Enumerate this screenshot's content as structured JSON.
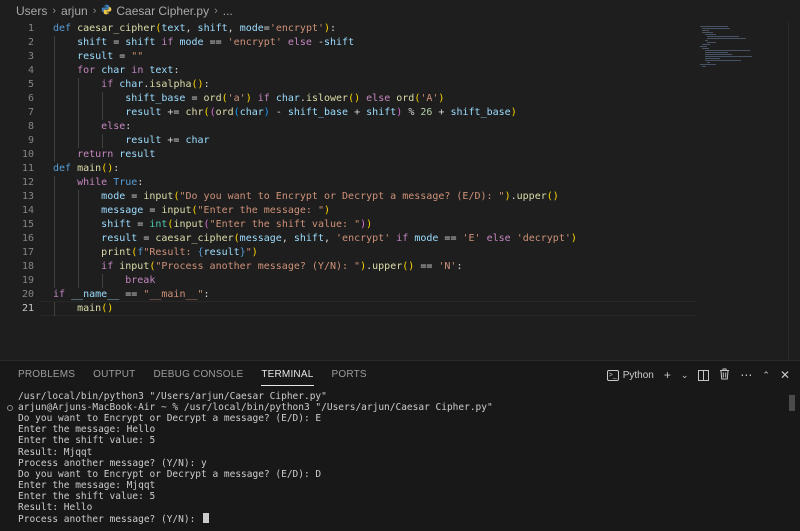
{
  "breadcrumb": {
    "items": [
      "Users",
      "arjun",
      "Caesar Cipher.py",
      "..."
    ]
  },
  "editor": {
    "active_line": 21,
    "lines": [
      [
        [
          "kw",
          "def "
        ],
        [
          "fn",
          "caesar_cipher"
        ],
        [
          "br1",
          "("
        ],
        [
          "var",
          "text"
        ],
        [
          "op",
          ", "
        ],
        [
          "var",
          "shift"
        ],
        [
          "op",
          ", "
        ],
        [
          "var",
          "mode"
        ],
        [
          "op",
          "="
        ],
        [
          "str",
          "'encrypt'"
        ],
        [
          "br1",
          ")"
        ],
        [
          "op",
          ":"
        ]
      ],
      [
        [
          "op",
          "    "
        ],
        [
          "var",
          "shift"
        ],
        [
          "op",
          " = "
        ],
        [
          "var",
          "shift"
        ],
        [
          "ctl",
          " if "
        ],
        [
          "var",
          "mode"
        ],
        [
          "op",
          " == "
        ],
        [
          "str",
          "'encrypt'"
        ],
        [
          "ctl",
          " else "
        ],
        [
          "op",
          "-"
        ],
        [
          "var",
          "shift"
        ]
      ],
      [
        [
          "op",
          "    "
        ],
        [
          "var",
          "result"
        ],
        [
          "op",
          " = "
        ],
        [
          "str",
          "\"\""
        ]
      ],
      [
        [
          "op",
          "    "
        ],
        [
          "ctl",
          "for "
        ],
        [
          "var",
          "char"
        ],
        [
          "ctl",
          " in "
        ],
        [
          "var",
          "text"
        ],
        [
          "op",
          ":"
        ]
      ],
      [
        [
          "op",
          "        "
        ],
        [
          "ctl",
          "if "
        ],
        [
          "var",
          "char"
        ],
        [
          "op",
          "."
        ],
        [
          "fn",
          "isalpha"
        ],
        [
          "br1",
          "()"
        ],
        [
          "op",
          ":"
        ]
      ],
      [
        [
          "op",
          "            "
        ],
        [
          "var",
          "shift_base"
        ],
        [
          "op",
          " = "
        ],
        [
          "fn",
          "ord"
        ],
        [
          "br1",
          "("
        ],
        [
          "str",
          "'a'"
        ],
        [
          "br1",
          ")"
        ],
        [
          "ctl",
          " if "
        ],
        [
          "var",
          "char"
        ],
        [
          "op",
          "."
        ],
        [
          "fn",
          "islower"
        ],
        [
          "br1",
          "()"
        ],
        [
          "ctl",
          " else "
        ],
        [
          "fn",
          "ord"
        ],
        [
          "br1",
          "("
        ],
        [
          "str",
          "'A'"
        ],
        [
          "br1",
          ")"
        ]
      ],
      [
        [
          "op",
          "            "
        ],
        [
          "var",
          "result"
        ],
        [
          "op",
          " += "
        ],
        [
          "fn",
          "chr"
        ],
        [
          "br1",
          "("
        ],
        [
          "br2",
          "("
        ],
        [
          "fn",
          "ord"
        ],
        [
          "br3",
          "("
        ],
        [
          "var",
          "char"
        ],
        [
          "br3",
          ")"
        ],
        [
          "op",
          " - "
        ],
        [
          "var",
          "shift_base"
        ],
        [
          "op",
          " + "
        ],
        [
          "var",
          "shift"
        ],
        [
          "br2",
          ")"
        ],
        [
          "op",
          " % "
        ],
        [
          "num",
          "26"
        ],
        [
          "op",
          " + "
        ],
        [
          "var",
          "shift_base"
        ],
        [
          "br1",
          ")"
        ]
      ],
      [
        [
          "op",
          "        "
        ],
        [
          "ctl",
          "else"
        ],
        [
          "op",
          ":"
        ]
      ],
      [
        [
          "op",
          "            "
        ],
        [
          "var",
          "result"
        ],
        [
          "op",
          " += "
        ],
        [
          "var",
          "char"
        ]
      ],
      [
        [
          "op",
          "    "
        ],
        [
          "ctl",
          "return "
        ],
        [
          "var",
          "result"
        ]
      ],
      [
        [
          "kw",
          "def "
        ],
        [
          "fn",
          "main"
        ],
        [
          "br1",
          "()"
        ],
        [
          "op",
          ":"
        ]
      ],
      [
        [
          "op",
          "    "
        ],
        [
          "ctl",
          "while "
        ],
        [
          "kw",
          "True"
        ],
        [
          "op",
          ":"
        ]
      ],
      [
        [
          "op",
          "        "
        ],
        [
          "var",
          "mode"
        ],
        [
          "op",
          " = "
        ],
        [
          "fn",
          "input"
        ],
        [
          "br1",
          "("
        ],
        [
          "str",
          "\"Do you want to Encrypt or Decrypt a message? (E/D): \""
        ],
        [
          "br1",
          ")"
        ],
        [
          "op",
          "."
        ],
        [
          "fn",
          "upper"
        ],
        [
          "br1",
          "()"
        ]
      ],
      [
        [
          "op",
          "        "
        ],
        [
          "var",
          "message"
        ],
        [
          "op",
          " = "
        ],
        [
          "fn",
          "input"
        ],
        [
          "br1",
          "("
        ],
        [
          "str",
          "\"Enter the message: \""
        ],
        [
          "br1",
          ")"
        ]
      ],
      [
        [
          "op",
          "        "
        ],
        [
          "var",
          "shift"
        ],
        [
          "op",
          " = "
        ],
        [
          "cls",
          "int"
        ],
        [
          "br1",
          "("
        ],
        [
          "fn",
          "input"
        ],
        [
          "br2",
          "("
        ],
        [
          "str",
          "\"Enter the shift value: \""
        ],
        [
          "br2",
          ")"
        ],
        [
          "br1",
          ")"
        ]
      ],
      [
        [
          "op",
          "        "
        ],
        [
          "var",
          "result"
        ],
        [
          "op",
          " = "
        ],
        [
          "fn",
          "caesar_cipher"
        ],
        [
          "br1",
          "("
        ],
        [
          "var",
          "message"
        ],
        [
          "op",
          ", "
        ],
        [
          "var",
          "shift"
        ],
        [
          "op",
          ", "
        ],
        [
          "str",
          "'encrypt'"
        ],
        [
          "ctl",
          " if "
        ],
        [
          "var",
          "mode"
        ],
        [
          "op",
          " == "
        ],
        [
          "str",
          "'E'"
        ],
        [
          "ctl",
          " else "
        ],
        [
          "str",
          "'decrypt'"
        ],
        [
          "br1",
          ")"
        ]
      ],
      [
        [
          "op",
          "        "
        ],
        [
          "fn",
          "print"
        ],
        [
          "br1",
          "("
        ],
        [
          "kw",
          "f"
        ],
        [
          "str",
          "\"Result: "
        ],
        [
          "kw",
          "{"
        ],
        [
          "var",
          "result"
        ],
        [
          "kw",
          "}"
        ],
        [
          "str",
          "\""
        ],
        [
          "br1",
          ")"
        ]
      ],
      [
        [
          "op",
          "        "
        ],
        [
          "ctl",
          "if "
        ],
        [
          "fn",
          "input"
        ],
        [
          "br1",
          "("
        ],
        [
          "str",
          "\"Process another message? (Y/N): \""
        ],
        [
          "br1",
          ")"
        ],
        [
          "op",
          "."
        ],
        [
          "fn",
          "upper"
        ],
        [
          "br1",
          "()"
        ],
        [
          "op",
          " == "
        ],
        [
          "str",
          "'N'"
        ],
        [
          "op",
          ":"
        ]
      ],
      [
        [
          "op",
          "            "
        ],
        [
          "ctl",
          "break"
        ]
      ],
      [
        [
          "ctl",
          "if "
        ],
        [
          "var",
          "__name__"
        ],
        [
          "op",
          " == "
        ],
        [
          "str",
          "\"__main__\""
        ],
        [
          "op",
          ":"
        ]
      ],
      [
        [
          "op",
          "    "
        ],
        [
          "fn",
          "main"
        ],
        [
          "br1",
          "()"
        ]
      ]
    ]
  },
  "panel": {
    "tabs": [
      "PROBLEMS",
      "OUTPUT",
      "DEBUG CONSOLE",
      "TERMINAL",
      "PORTS"
    ],
    "active_tab": "TERMINAL",
    "terminal_name": "Python"
  },
  "terminal": {
    "lines": [
      "/usr/local/bin/python3 \"/Users/arjun/Caesar Cipher.py\"",
      "arjun@Arjuns-MacBook-Air ~ % /usr/local/bin/python3 \"/Users/arjun/Caesar Cipher.py\"",
      "Do you want to Encrypt or Decrypt a message? (E/D): E",
      "Enter the message: Hello",
      "Enter the shift value: 5",
      "Result: Mjqqt",
      "Process another message? (Y/N): y",
      "Do you want to Encrypt or Decrypt a message? (E/D): D",
      "Enter the message: Mjqqt",
      "Enter the shift value: 5",
      "Result: Hello",
      "Process another message? (Y/N): "
    ]
  }
}
